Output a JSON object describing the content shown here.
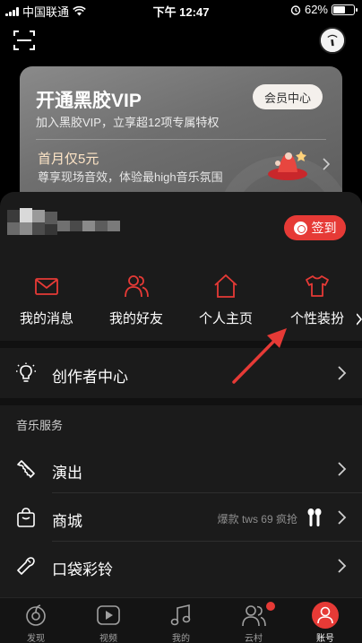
{
  "status_bar": {
    "carrier": "中国联通",
    "time": "下午 12:47",
    "battery": "62%",
    "battery_level": 0.62
  },
  "vip": {
    "title": "开通黑胶VIP",
    "subtitle": "加入黑胶VIP，立享超12项专属特权",
    "center_button": "会员中心",
    "promo_title": "首月仅5元",
    "promo_subtitle": "尊享现场音效，体验最high音乐氛围"
  },
  "checkin": {
    "label": "签到"
  },
  "shortcuts": [
    {
      "label": "我的消息",
      "icon": "mail-icon"
    },
    {
      "label": "我的好友",
      "icon": "friends-icon"
    },
    {
      "label": "个人主页",
      "icon": "home-icon"
    },
    {
      "label": "个性装扮",
      "icon": "tshirt-icon"
    }
  ],
  "creator": {
    "label": "创作者中心",
    "icon": "lightbulb-icon"
  },
  "music_services": {
    "title": "音乐服务",
    "items": [
      {
        "label": "演出",
        "icon": "ticket-icon"
      },
      {
        "label": "商城",
        "icon": "shopping-bag-icon",
        "extra": "爆款 tws 69 疯抢"
      },
      {
        "label": "口袋彩铃",
        "icon": "ringtone-icon"
      }
    ]
  },
  "tabbar": [
    {
      "label": "发现",
      "icon": "discover-icon"
    },
    {
      "label": "视频",
      "icon": "video-icon"
    },
    {
      "label": "我的",
      "icon": "music-note-icon"
    },
    {
      "label": "云村",
      "icon": "community-icon"
    },
    {
      "label": "账号",
      "icon": "account-icon",
      "active": true
    }
  ],
  "colors": {
    "accent": "#e63a36",
    "background": "#000000",
    "sheet": "#1b1b1b"
  }
}
